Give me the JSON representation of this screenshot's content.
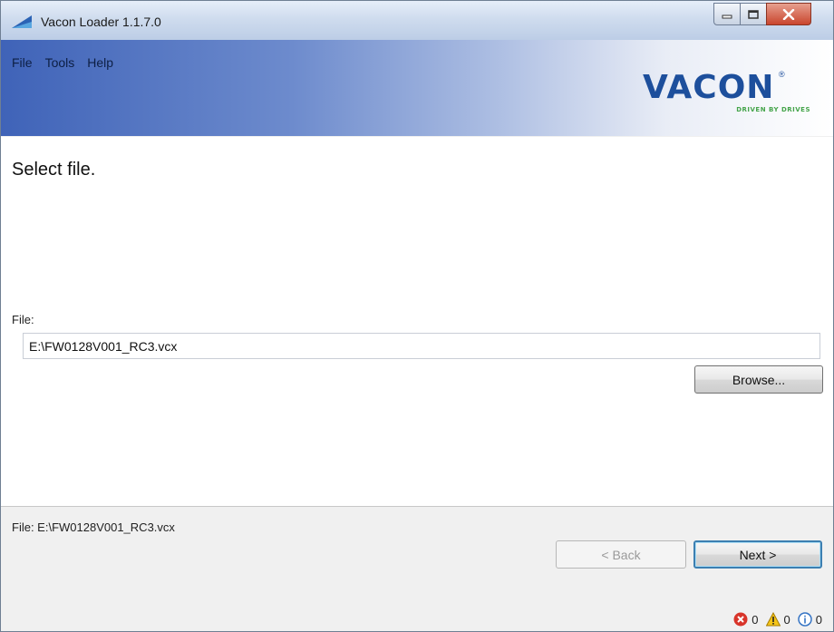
{
  "window": {
    "title": "Vacon Loader 1.1.7.0",
    "controls": [
      "minimize-icon",
      "maximize-icon",
      "close-icon"
    ]
  },
  "menu": {
    "items": [
      "File",
      "Tools",
      "Help"
    ]
  },
  "logo": {
    "brand": "VACON",
    "tagline": "DRIVEN BY DRIVES",
    "brand_color": "#1d4f9c",
    "tagline_color": "#44a44a"
  },
  "content": {
    "heading": "Select file.",
    "file_label": "File:",
    "file_value": "E:\\FW0128V001_RC3.vcx",
    "browse_label": "Browse..."
  },
  "footer": {
    "status_text": "File: E:\\FW0128V001_RC3.vcx",
    "back_label": "< Back",
    "next_label": "Next >",
    "errors": "0",
    "warnings": "0",
    "infos": "0"
  },
  "icons": {
    "error": "error-icon",
    "warning": "warning-icon",
    "info": "info-icon"
  }
}
